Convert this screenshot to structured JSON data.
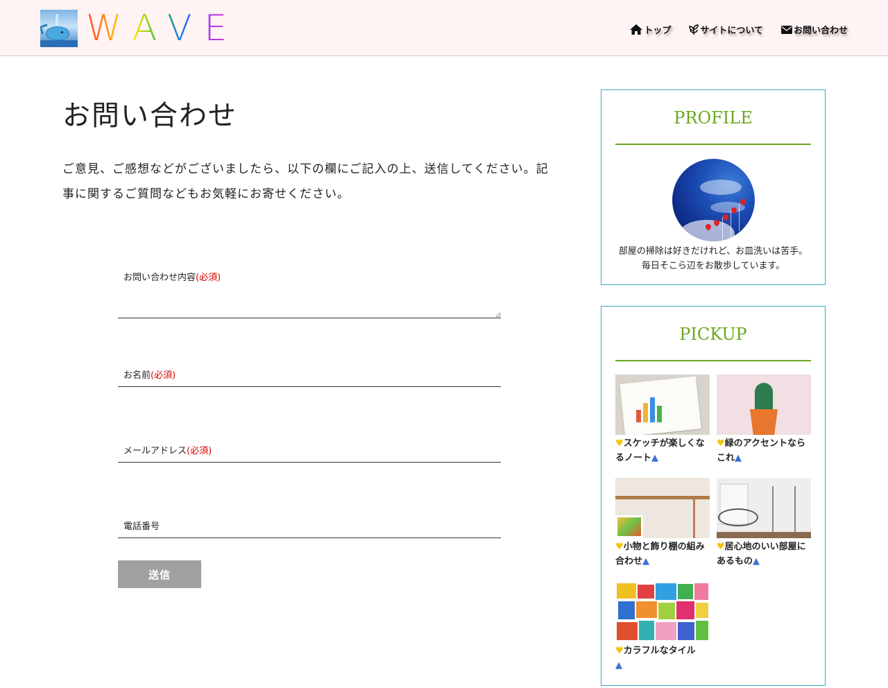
{
  "header": {
    "logo_text": "WAVE",
    "nav": [
      {
        "label": "トップ",
        "icon": "home-icon"
      },
      {
        "label": "サイトについて",
        "icon": "leaf-icon"
      },
      {
        "label": "お問い合わせ",
        "icon": "envelope-icon"
      }
    ]
  },
  "main": {
    "title": "お問い合わせ",
    "intro": "ご意見、ご感想などがございましたら、以下の欄にご記入の上、送信してください。記事に関するご質問などもお気軽にお寄せください。"
  },
  "form": {
    "required_mark": "(必須)",
    "fields": [
      {
        "label": "お問い合わせ内容",
        "required": true,
        "type": "textarea"
      },
      {
        "label": "お名前",
        "required": true,
        "type": "text"
      },
      {
        "label": "メールアドレス",
        "required": true,
        "type": "email"
      },
      {
        "label": "電話番号",
        "required": false,
        "type": "tel"
      }
    ],
    "submit_label": "送信"
  },
  "sidebar": {
    "profile": {
      "title": "PROFILE",
      "text": "部屋の掃除は好きだけれど、お皿洗いは苦手。毎日そこら辺をお散歩しています。"
    },
    "pickup": {
      "title": "PICKUP",
      "items": [
        {
          "caption": "スケッチが楽しくなるノート"
        },
        {
          "caption": "緑のアクセントならこれ"
        },
        {
          "caption": "小物と飾り棚の組み合わせ"
        },
        {
          "caption": "居心地のいい部屋にあるもの"
        },
        {
          "caption": "カラフルなタイル"
        }
      ]
    }
  },
  "colors": {
    "header_bg": "#fff3f3",
    "accent_green": "#6aa820",
    "widget_border": "#3aa8c0",
    "required_red": "#e00000",
    "submit_bg": "#a0a0a0"
  }
}
